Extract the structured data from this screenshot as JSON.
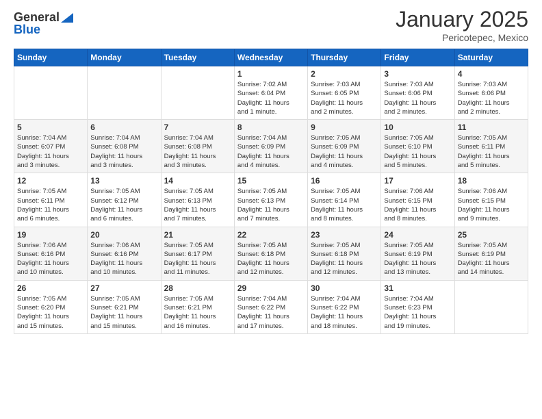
{
  "header": {
    "logo_general": "General",
    "logo_blue": "Blue",
    "month": "January 2025",
    "location": "Pericotepec, Mexico"
  },
  "days_of_week": [
    "Sunday",
    "Monday",
    "Tuesday",
    "Wednesday",
    "Thursday",
    "Friday",
    "Saturday"
  ],
  "weeks": [
    [
      {
        "day": "",
        "info": ""
      },
      {
        "day": "",
        "info": ""
      },
      {
        "day": "",
        "info": ""
      },
      {
        "day": "1",
        "info": "Sunrise: 7:02 AM\nSunset: 6:04 PM\nDaylight: 11 hours\nand 1 minute."
      },
      {
        "day": "2",
        "info": "Sunrise: 7:03 AM\nSunset: 6:05 PM\nDaylight: 11 hours\nand 2 minutes."
      },
      {
        "day": "3",
        "info": "Sunrise: 7:03 AM\nSunset: 6:06 PM\nDaylight: 11 hours\nand 2 minutes."
      },
      {
        "day": "4",
        "info": "Sunrise: 7:03 AM\nSunset: 6:06 PM\nDaylight: 11 hours\nand 2 minutes."
      }
    ],
    [
      {
        "day": "5",
        "info": "Sunrise: 7:04 AM\nSunset: 6:07 PM\nDaylight: 11 hours\nand 3 minutes."
      },
      {
        "day": "6",
        "info": "Sunrise: 7:04 AM\nSunset: 6:08 PM\nDaylight: 11 hours\nand 3 minutes."
      },
      {
        "day": "7",
        "info": "Sunrise: 7:04 AM\nSunset: 6:08 PM\nDaylight: 11 hours\nand 3 minutes."
      },
      {
        "day": "8",
        "info": "Sunrise: 7:04 AM\nSunset: 6:09 PM\nDaylight: 11 hours\nand 4 minutes."
      },
      {
        "day": "9",
        "info": "Sunrise: 7:05 AM\nSunset: 6:09 PM\nDaylight: 11 hours\nand 4 minutes."
      },
      {
        "day": "10",
        "info": "Sunrise: 7:05 AM\nSunset: 6:10 PM\nDaylight: 11 hours\nand 5 minutes."
      },
      {
        "day": "11",
        "info": "Sunrise: 7:05 AM\nSunset: 6:11 PM\nDaylight: 11 hours\nand 5 minutes."
      }
    ],
    [
      {
        "day": "12",
        "info": "Sunrise: 7:05 AM\nSunset: 6:11 PM\nDaylight: 11 hours\nand 6 minutes."
      },
      {
        "day": "13",
        "info": "Sunrise: 7:05 AM\nSunset: 6:12 PM\nDaylight: 11 hours\nand 6 minutes."
      },
      {
        "day": "14",
        "info": "Sunrise: 7:05 AM\nSunset: 6:13 PM\nDaylight: 11 hours\nand 7 minutes."
      },
      {
        "day": "15",
        "info": "Sunrise: 7:05 AM\nSunset: 6:13 PM\nDaylight: 11 hours\nand 7 minutes."
      },
      {
        "day": "16",
        "info": "Sunrise: 7:05 AM\nSunset: 6:14 PM\nDaylight: 11 hours\nand 8 minutes."
      },
      {
        "day": "17",
        "info": "Sunrise: 7:06 AM\nSunset: 6:15 PM\nDaylight: 11 hours\nand 8 minutes."
      },
      {
        "day": "18",
        "info": "Sunrise: 7:06 AM\nSunset: 6:15 PM\nDaylight: 11 hours\nand 9 minutes."
      }
    ],
    [
      {
        "day": "19",
        "info": "Sunrise: 7:06 AM\nSunset: 6:16 PM\nDaylight: 11 hours\nand 10 minutes."
      },
      {
        "day": "20",
        "info": "Sunrise: 7:06 AM\nSunset: 6:16 PM\nDaylight: 11 hours\nand 10 minutes."
      },
      {
        "day": "21",
        "info": "Sunrise: 7:05 AM\nSunset: 6:17 PM\nDaylight: 11 hours\nand 11 minutes."
      },
      {
        "day": "22",
        "info": "Sunrise: 7:05 AM\nSunset: 6:18 PM\nDaylight: 11 hours\nand 12 minutes."
      },
      {
        "day": "23",
        "info": "Sunrise: 7:05 AM\nSunset: 6:18 PM\nDaylight: 11 hours\nand 12 minutes."
      },
      {
        "day": "24",
        "info": "Sunrise: 7:05 AM\nSunset: 6:19 PM\nDaylight: 11 hours\nand 13 minutes."
      },
      {
        "day": "25",
        "info": "Sunrise: 7:05 AM\nSunset: 6:19 PM\nDaylight: 11 hours\nand 14 minutes."
      }
    ],
    [
      {
        "day": "26",
        "info": "Sunrise: 7:05 AM\nSunset: 6:20 PM\nDaylight: 11 hours\nand 15 minutes."
      },
      {
        "day": "27",
        "info": "Sunrise: 7:05 AM\nSunset: 6:21 PM\nDaylight: 11 hours\nand 15 minutes."
      },
      {
        "day": "28",
        "info": "Sunrise: 7:05 AM\nSunset: 6:21 PM\nDaylight: 11 hours\nand 16 minutes."
      },
      {
        "day": "29",
        "info": "Sunrise: 7:04 AM\nSunset: 6:22 PM\nDaylight: 11 hours\nand 17 minutes."
      },
      {
        "day": "30",
        "info": "Sunrise: 7:04 AM\nSunset: 6:22 PM\nDaylight: 11 hours\nand 18 minutes."
      },
      {
        "day": "31",
        "info": "Sunrise: 7:04 AM\nSunset: 6:23 PM\nDaylight: 11 hours\nand 19 minutes."
      },
      {
        "day": "",
        "info": ""
      }
    ]
  ]
}
